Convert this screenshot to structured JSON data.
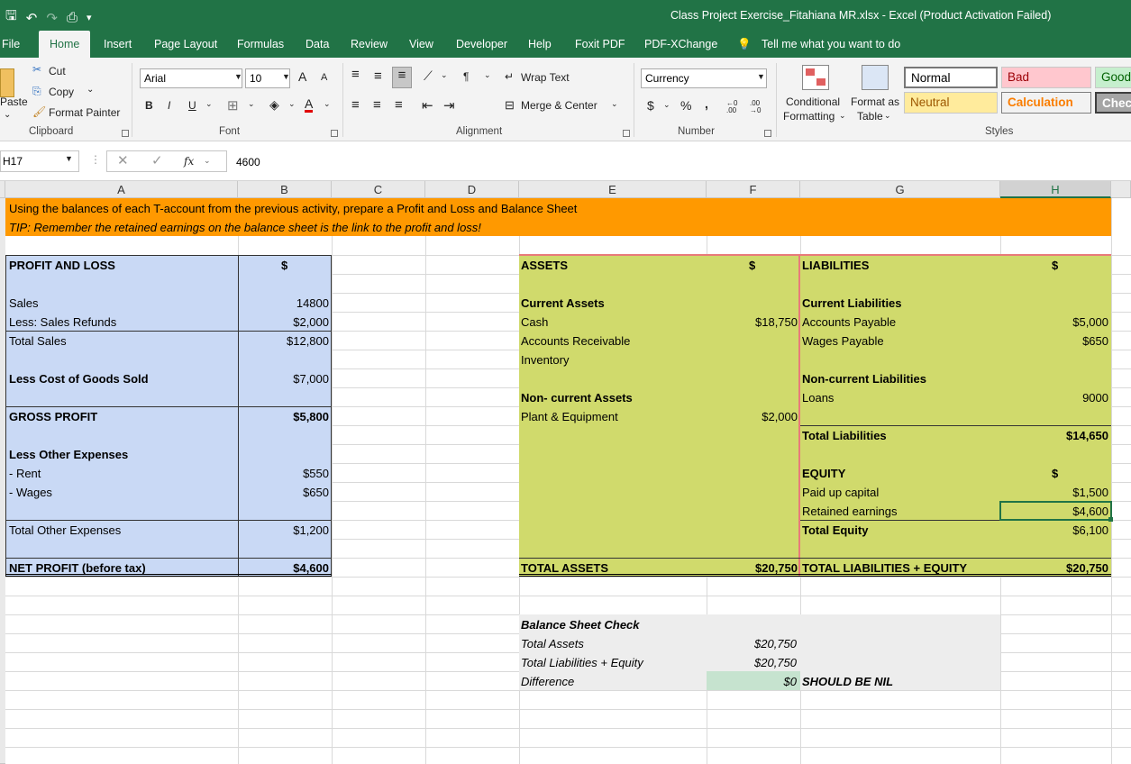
{
  "titlebar": {
    "title": "Class Project Exercise_Fitahiana MR.xlsx  -  Excel (Product Activation Failed)",
    "icons": [
      "save-icon",
      "undo-icon",
      "redo-icon",
      "print-preview-icon",
      "customize-qat-icon"
    ]
  },
  "tabs": [
    "File",
    "Home",
    "Insert",
    "Page Layout",
    "Formulas",
    "Data",
    "Review",
    "View",
    "Developer",
    "Help",
    "Foxit PDF",
    "PDF-XChange"
  ],
  "active_tab": "Home",
  "tell_me": "Tell me what you want to do",
  "ribbon": {
    "clipboard": {
      "paste": "Paste",
      "cut": "Cut",
      "copy": "Copy",
      "format_painter": "Format Painter",
      "label": "Clipboard"
    },
    "font": {
      "name": "Arial",
      "size": "10",
      "label": "Font",
      "bold": "B",
      "italic": "I",
      "underline": "U",
      "grow": "A",
      "shrink": "A",
      "font_color": "A"
    },
    "alignment": {
      "wrap": "Wrap Text",
      "merge": "Merge & Center",
      "label": "Alignment"
    },
    "number": {
      "format": "Currency",
      "dollar": "$",
      "percent": "%",
      "comma": ",",
      "label": "Number",
      "increase_decimal": "←0 .00",
      "decrease_decimal": ".00 →0"
    },
    "styles": {
      "conditional": "Conditional",
      "conditional2": "Formatting",
      "format_as": "Format as",
      "format_as2": "Table",
      "normal": "Normal",
      "bad": "Bad",
      "good": "Good",
      "neutral": "Neutral",
      "calculation": "Calculation",
      "check": "Chec",
      "label": "Styles"
    }
  },
  "formula_bar": {
    "name_box": "H17",
    "value": "4600",
    "fx": "fx"
  },
  "columns": [
    "A",
    "B",
    "C",
    "D",
    "E",
    "F",
    "G",
    "H"
  ],
  "colors": {
    "excel_green": "#217346",
    "banner": "#ff9900",
    "pl_fill": "#c9d9f5",
    "bs_fill": "#d0da6c",
    "check_fill": "#ededed",
    "diff_fill": "#c6e3cf",
    "border_red": "#e87a7a"
  },
  "sheet": {
    "banner1": "Using the balances of each T-account from the previous activity, prepare a Profit and Loss and Balance Sheet",
    "banner2": "TIP: Remember the retained earnings on the balance sheet is the link to the profit and loss!",
    "pl": {
      "title": "PROFIT AND LOSS",
      "currency": "$",
      "sales": "Sales",
      "sales_v": "14800",
      "refunds": "Less: Sales Refunds",
      "refunds_v": "$2,000",
      "total_sales": "Total Sales",
      "total_sales_v": "$12,800",
      "cogs": "Less Cost of Goods Sold",
      "cogs_v": "$7,000",
      "gross": "GROSS PROFIT",
      "gross_v": "$5,800",
      "other": "Less Other Expenses",
      "rent": "- Rent",
      "rent_v": "$550",
      "wages": "- Wages",
      "wages_v": "$650",
      "total_other": "Total Other Expenses",
      "total_other_v": "$1,200",
      "net": "NET PROFIT (before tax)",
      "net_v": "$4,600"
    },
    "assets": {
      "title": "ASSETS",
      "currency": "$",
      "current": "Current Assets",
      "cash": "Cash",
      "cash_v": "$18,750",
      "ar": "Accounts Receivable",
      "inventory": "Inventory",
      "noncurrent": "Non- current Assets",
      "plant": "Plant & Equipment",
      "plant_v": "$2,000",
      "total": "TOTAL ASSETS",
      "total_v": "$20,750"
    },
    "liabilities": {
      "title": "LIABILITIES",
      "currency": "$",
      "current": "Current Liabilities",
      "ap": "Accounts Payable",
      "ap_v": "$5,000",
      "wp": "Wages Payable",
      "wp_v": "$650",
      "noncurrent": "Non-current Liabilities",
      "loans": "Loans",
      "loans_v": "9000",
      "total": "Total Liabilities",
      "total_v": "$14,650",
      "equity": "EQUITY",
      "equity_cur": "$",
      "capital": "Paid up capital",
      "capital_v": "$1,500",
      "retained": "Retained earnings",
      "retained_v": "$4,600",
      "total_equity": "Total Equity",
      "total_equity_v": "$6,100",
      "total_le": "TOTAL LIABILITIES + EQUITY",
      "total_le_v": "$20,750"
    },
    "check": {
      "title": "Balance Sheet Check",
      "ta": "Total Assets",
      "ta_v": "$20,750",
      "tle": "Total Liabilities + Equity",
      "tle_v": "$20,750",
      "diff": "Difference",
      "diff_v": "$0",
      "note": "SHOULD BE NIL"
    }
  }
}
